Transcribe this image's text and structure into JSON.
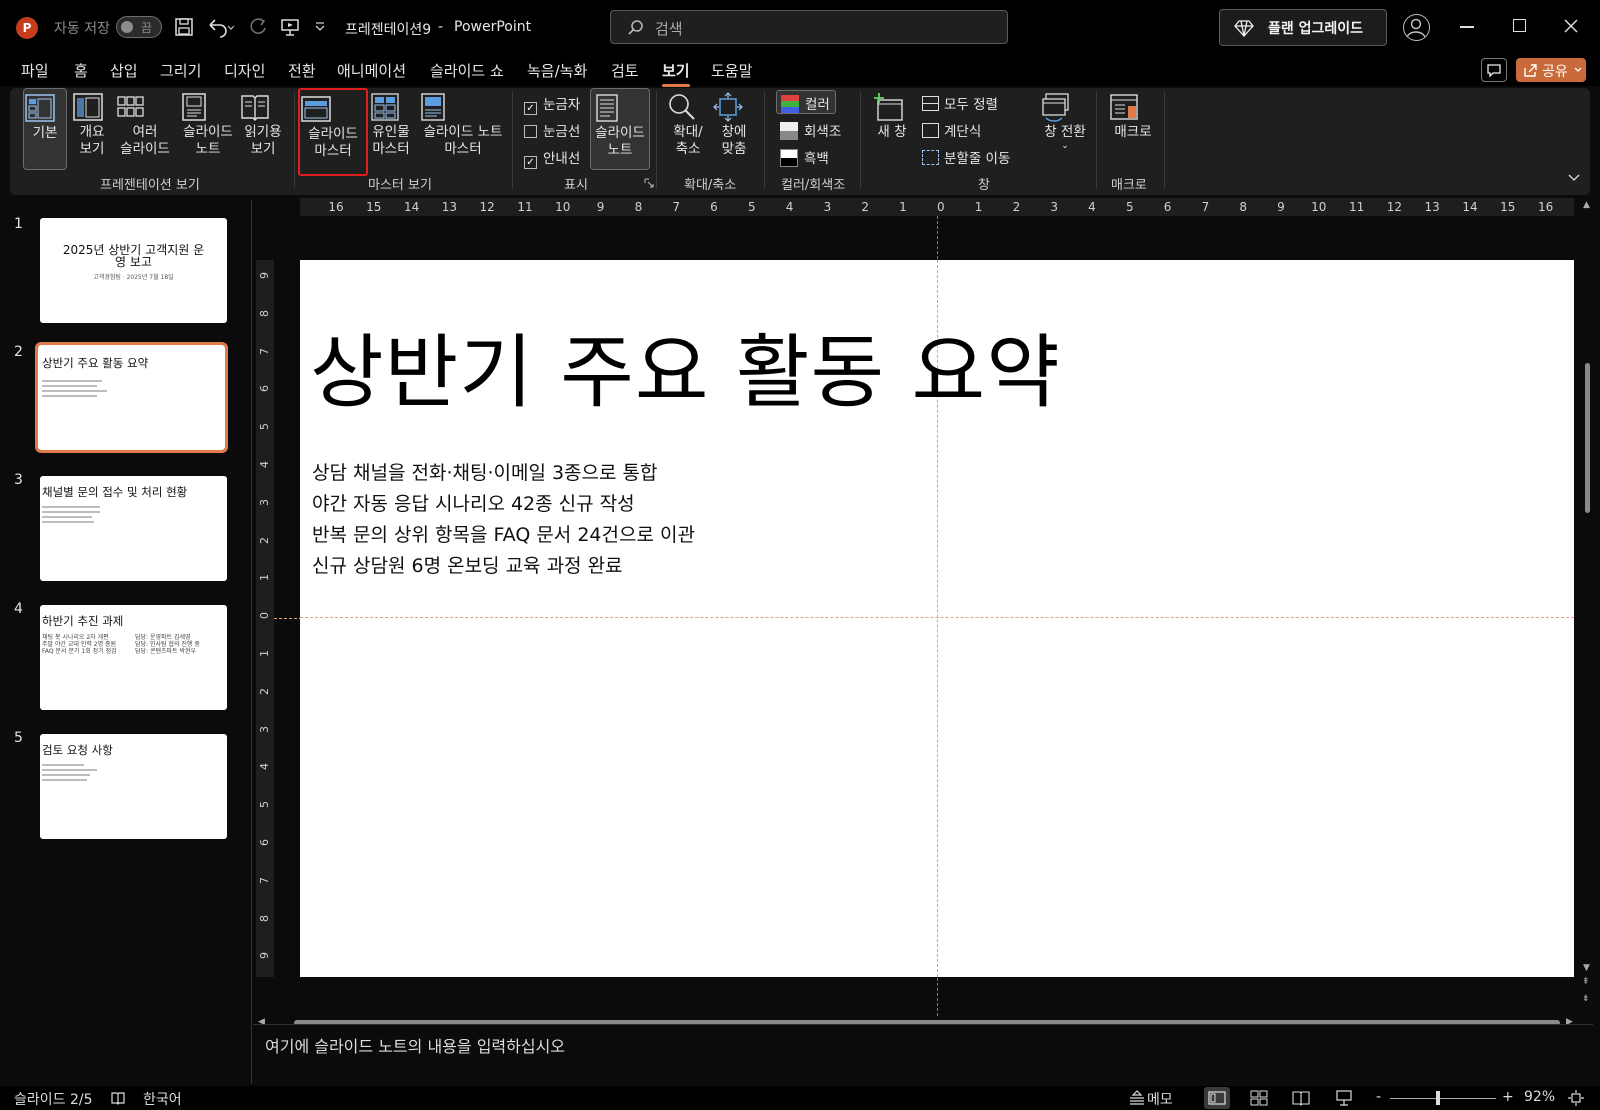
{
  "titlebar": {
    "autosave_label": "자동 저장",
    "autosave_state": "끔",
    "doc_title": "프레젠테이션9",
    "separator": "-",
    "app_name": "PowerPoint",
    "search_placeholder": "검색",
    "upgrade_label": "플랜 업그레이드"
  },
  "menu": {
    "tabs": [
      "파일",
      "홈",
      "삽입",
      "그리기",
      "디자인",
      "전환",
      "애니메이션",
      "슬라이드 쇼",
      "녹음/녹화",
      "검토",
      "보기",
      "도움말"
    ],
    "active": "보기",
    "share_label": "공유"
  },
  "ribbon": {
    "presentation_views": {
      "group": "프레젠테이션 보기",
      "normal": [
        "기본"
      ],
      "outline": [
        "개요",
        "보기"
      ],
      "sorter": [
        "여러",
        "슬라이드"
      ],
      "notes": [
        "슬라이드",
        "노트"
      ],
      "reading": [
        "읽기용",
        "보기"
      ]
    },
    "master_views": {
      "group": "마스터 보기",
      "slide_master": [
        "슬라이드",
        "마스터"
      ],
      "handout_master": [
        "유인물",
        "마스터"
      ],
      "notes_master": [
        "슬라이드 노트",
        "마스터"
      ]
    },
    "show": {
      "group": "표시",
      "ruler": "눈금자",
      "gridlines": "눈금선",
      "guides": "안내선",
      "notes": [
        "슬라이드",
        "노트"
      ]
    },
    "zoom": {
      "group": "확대/축소",
      "zoom": [
        "확대/",
        "축소"
      ],
      "fit": [
        "창에",
        "맞춤"
      ]
    },
    "color": {
      "group": "컬러/회색조",
      "color": "컬러",
      "grayscale": "회색조",
      "bw": "흑백"
    },
    "window": {
      "group": "창",
      "new_window": "새 창",
      "arrange_all": "모두 정렬",
      "cascade": "계단식",
      "move_split": "분할줄 이동",
      "switch": "창 전환"
    },
    "macros": {
      "group": "매크로",
      "macros": "매크로"
    },
    "colors": {
      "accent": "#e07a4a",
      "highlight_box": "#e02020"
    }
  },
  "thumbnails": [
    {
      "num": "1",
      "title": "2025년 상반기 고객지원 운",
      "title2": "영 보고",
      "sub": "고객경험팀 · 2025년 7월 18일"
    },
    {
      "num": "2",
      "title": "상반기 주요 활동 요약"
    },
    {
      "num": "3",
      "title": "채널별 문의 접수 및 처리 현황"
    },
    {
      "num": "4",
      "title": "하반기 추진 과제",
      "left_lines": [
        "채팅 봇 시나리오 2차 개편",
        "주말 야간 교대 인력 2명 충원",
        "FAQ 문서 분기 1회 정기 점검"
      ],
      "right_lines": [
        "담당: 운영파트 김세영",
        "담당: 인사팀 협의 진행 중",
        "담당: 콘텐츠파트 박현우"
      ]
    },
    {
      "num": "5",
      "title": "검토 요청 사항"
    }
  ],
  "ruler": {
    "top": [
      "16",
      "15",
      "14",
      "13",
      "12",
      "11",
      "10",
      "9",
      "8",
      "7",
      "6",
      "5",
      "4",
      "3",
      "2",
      "1",
      "0",
      "1",
      "2",
      "3",
      "4",
      "5",
      "6",
      "7",
      "8",
      "9",
      "10",
      "11",
      "12",
      "13",
      "14",
      "15",
      "16"
    ],
    "left": [
      "9",
      "8",
      "7",
      "6",
      "5",
      "4",
      "3",
      "2",
      "1",
      "0",
      "1",
      "2",
      "3",
      "4",
      "5",
      "6",
      "7",
      "8",
      "9"
    ]
  },
  "slide": {
    "title": "상반기 주요 활동 요약",
    "bullets": [
      "상담 채널을 전화·채팅·이메일 3종으로 통합",
      "야간 자동 응답 시나리오 42종 신규 작성",
      "반복 문의 상위 항목을 FAQ 문서 24건으로 이관",
      "신규 상담원 6명 온보딩 교육 과정 완료"
    ]
  },
  "notes": {
    "placeholder": "여기에 슬라이드 노트의 내용을 입력하십시오"
  },
  "status": {
    "slide_indicator": "슬라이드 2/5",
    "language": "한국어",
    "notes_btn": "메모",
    "zoom_level": "92%",
    "zoom_minus": "-",
    "zoom_plus": "+"
  }
}
